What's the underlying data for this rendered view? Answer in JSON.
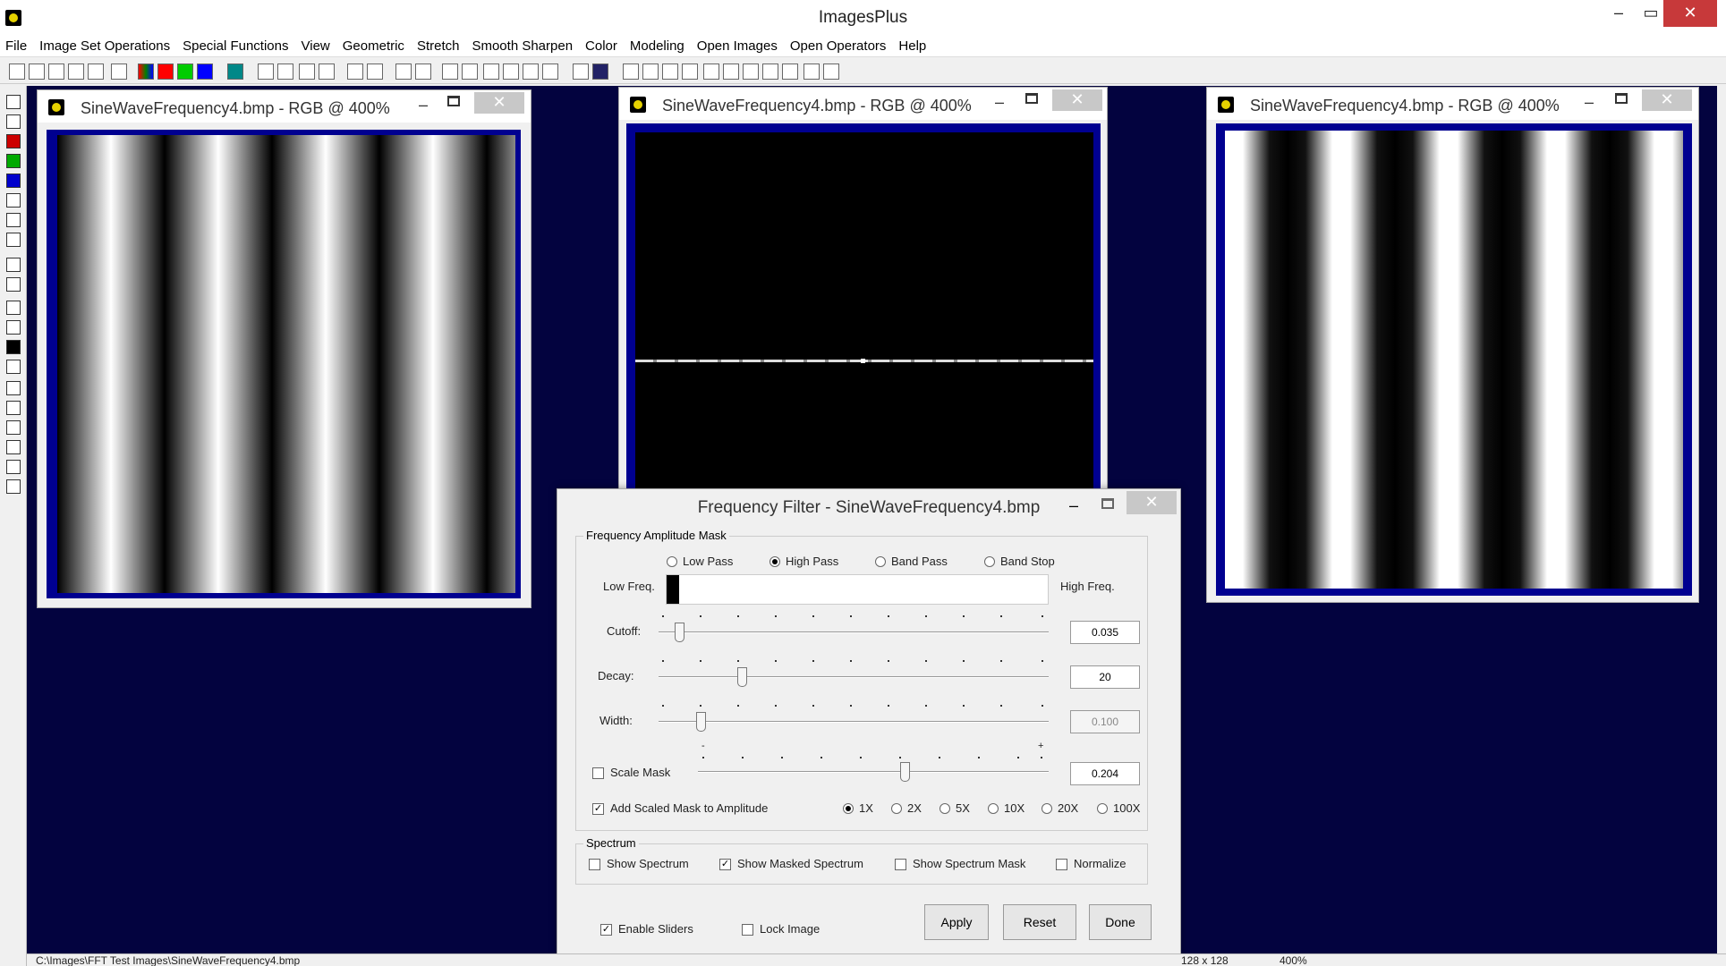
{
  "app": {
    "title": "ImagesPlus"
  },
  "menu": [
    "File",
    "Image Set Operations",
    "Special Functions",
    "View",
    "Geometric",
    "Stretch",
    "Smooth Sharpen",
    "Color",
    "Modeling",
    "Open Images",
    "Open Operators",
    "Help"
  ],
  "windows": [
    {
      "title": "SineWaveFrequency4.bmp - RGB @ 400%"
    },
    {
      "title": "SineWaveFrequency4.bmp - RGB @ 400%"
    },
    {
      "title": "SineWaveFrequency4.bmp - RGB @ 400%"
    }
  ],
  "dialog": {
    "title": "Frequency Filter - SineWaveFrequency4.bmp",
    "amplitude_group": "Frequency Amplitude Mask",
    "filter_types": [
      "Low Pass",
      "High Pass",
      "Band Pass",
      "Band Stop"
    ],
    "selected_filter": "High Pass",
    "low_freq": "Low Freq.",
    "high_freq": "High Freq.",
    "cutoff": {
      "label": "Cutoff:",
      "value": "0.035"
    },
    "decay": {
      "label": "Decay:",
      "value": "20"
    },
    "width": {
      "label": "Width:",
      "value": "0.100"
    },
    "scale_mask": {
      "label": "Scale Mask",
      "value": "0.204",
      "minus": "-",
      "plus": "+"
    },
    "add_scaled": {
      "label": "Add Scaled Mask to Amplitude",
      "checked": true
    },
    "multipliers": [
      "1X",
      "2X",
      "5X",
      "10X",
      "20X",
      "100X"
    ],
    "selected_multiplier": "1X",
    "spectrum_group": "Spectrum",
    "spectrum_options": [
      "Show Spectrum",
      "Show Masked Spectrum",
      "Show Spectrum Mask",
      "Normalize"
    ],
    "enable_sliders": "Enable Sliders",
    "lock_image": "Lock Image",
    "buttons": {
      "apply": "Apply",
      "reset": "Reset",
      "done": "Done"
    }
  },
  "status": {
    "path": "C:\\Images\\FFT Test Images\\SineWaveFrequency4.bmp",
    "size": "128 x 128",
    "zoom": "400%"
  }
}
